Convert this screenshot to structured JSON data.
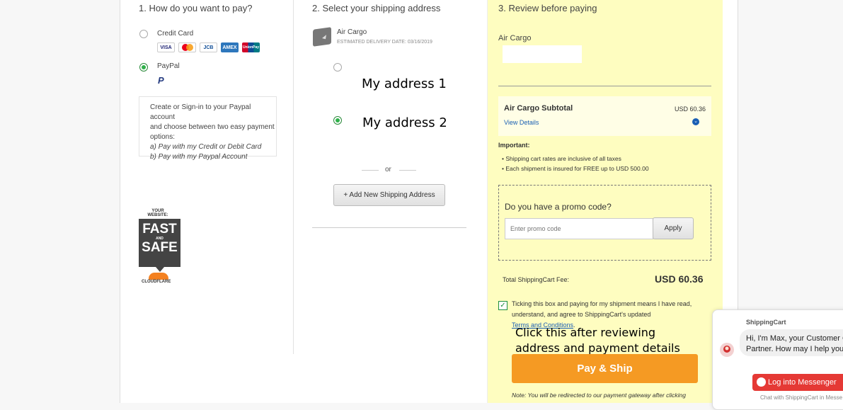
{
  "payment": {
    "step_title": "1. How do you want to pay?",
    "credit_card_label": "Credit Card",
    "cards": [
      "VISA",
      "MC",
      "JCB",
      "AMEX",
      "UnionPay"
    ],
    "paypal_label": "PayPal",
    "paypal_info": {
      "line1": "Create or Sign-in to your Paypal account",
      "line2": "and choose between two easy payment",
      "line3": "options:",
      "option_a": "a) Pay with my Credit or Debit Card",
      "option_b": "b) Pay with my Paypal Account"
    },
    "badge": {
      "top": "YOUR WEBSITE:",
      "fast": "FAST",
      "and": "AND",
      "safe": "SAFE",
      "brand": "CLOUDFLARE"
    }
  },
  "shipping": {
    "step_title": "2. Select your shipping address",
    "method_name": "Air Cargo",
    "delivery_label": "ESTIMATED DELIVERY DATE:",
    "delivery_date": "03/16/2019",
    "addresses": [
      "My address 1",
      "My address 2"
    ],
    "selected_address_index": 1,
    "or_text": "or",
    "add_button": "+ Add New Shipping Address"
  },
  "review": {
    "step_title": "3. Review before paying",
    "method_name": "Air Cargo",
    "subtotal_label": "Air Cargo Subtotal",
    "subtotal_value": "USD 60.36",
    "view_details": "View Details",
    "important_title": "Important:",
    "important_items": [
      "Shipping cart rates are inclusive of all taxes",
      "Each shipment is insured for FREE up to USD 500.00"
    ],
    "promo_title": "Do you have a promo code?",
    "promo_placeholder": "Enter promo code",
    "apply_label": "Apply",
    "total_label": "Total ShippingCart Fee:",
    "total_value": "USD 60.36",
    "terms_line1": "Ticking this box and paying for my shipment means I have read,",
    "terms_line2": "understand, and agree to ShippingCart's updated",
    "terms_link": "Terms and Conditions",
    "terms_suffix": ".",
    "annotation_line1": "Click this after reviewing",
    "annotation_line2": "address and payment details",
    "pay_button": "Pay & Ship",
    "redirect_note": "Note: You will be redirected to our payment gateway after clicking"
  },
  "chat": {
    "sender": "ShippingCart",
    "message_line1": "Hi, I'm Max, your Customer C",
    "message_line2": "Partner. How may I help you",
    "login_button": "Log into Messenger",
    "footer": "Chat with ShippingCart in Messe"
  },
  "colors": {
    "review_bg": "#fefdc0",
    "pay_button": "#f59a23",
    "messenger_red": "#e53935",
    "radio_on": "#2fb14a",
    "link": "#1a5fb4"
  }
}
